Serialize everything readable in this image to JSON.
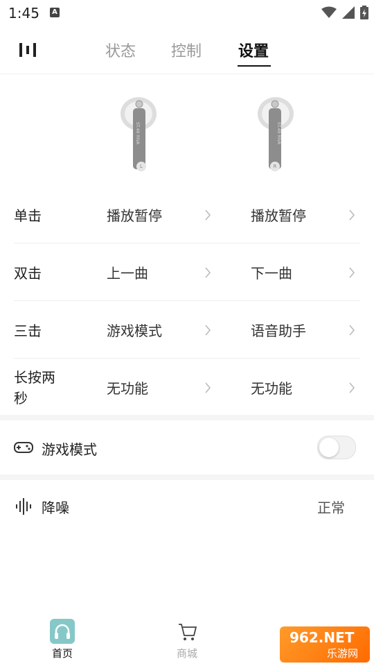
{
  "status_bar": {
    "time": "1:45",
    "notif_icon": "A"
  },
  "header": {
    "tabs": [
      {
        "label": "状态"
      },
      {
        "label": "控制"
      },
      {
        "label": "设置"
      }
    ]
  },
  "earbuds": {
    "left_label": "L",
    "right_label": "R",
    "engraving": "ST.49 RIVA"
  },
  "settings": {
    "rows": [
      {
        "label": "单击",
        "left": "播放暂停",
        "right": "播放暂停"
      },
      {
        "label": "双击",
        "left": "上一曲",
        "right": "下一曲"
      },
      {
        "label": "三击",
        "left": "游戏模式",
        "right": "语音助手"
      },
      {
        "label": "长按两秒",
        "left": "无功能",
        "right": "无功能"
      }
    ]
  },
  "game_mode": {
    "label": "游戏模式",
    "enabled": false
  },
  "noise": {
    "label": "降噪",
    "value": "正常"
  },
  "bottom_nav": {
    "items": [
      {
        "label": "首页",
        "active": true,
        "color": "#111111"
      },
      {
        "label": "商城",
        "active": false,
        "color": "#aaaaaa"
      }
    ]
  },
  "watermark": {
    "brand": "962.NET",
    "sub": "乐游网"
  },
  "colors": {
    "accent": "#86c8c8"
  }
}
